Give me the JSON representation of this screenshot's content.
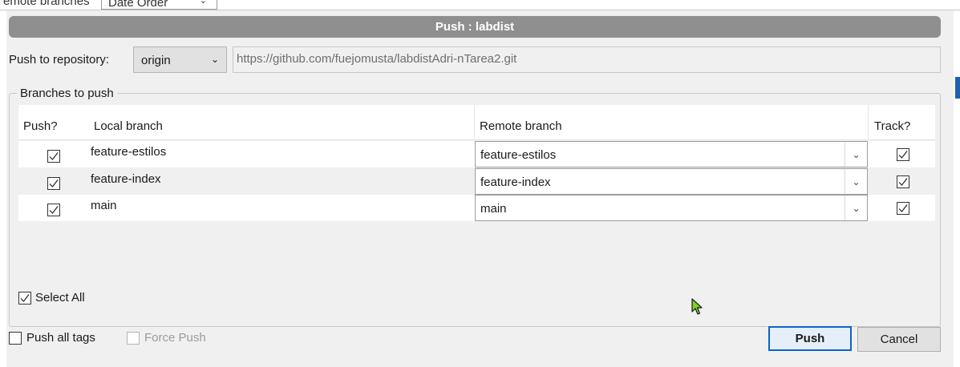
{
  "background": {
    "partial_text": "emote branches",
    "partial_select": "Date Order"
  },
  "dialog": {
    "title": "Push : labdist"
  },
  "repository": {
    "label": "Push to repository:",
    "selected": "origin",
    "url": "https://github.com/fuejomusta/labdistAdri-nTarea2.git"
  },
  "branches": {
    "group_label": "Branches to push",
    "columns": {
      "push": "Push?",
      "local": "Local branch",
      "remote": "Remote branch",
      "track": "Track?"
    },
    "rows": [
      {
        "push": true,
        "local": "feature-estilos",
        "remote": "feature-estilos",
        "track": true
      },
      {
        "push": true,
        "local": "feature-index",
        "remote": "feature-index",
        "track": true
      },
      {
        "push": true,
        "local": "main",
        "remote": "main",
        "track": true
      }
    ],
    "select_all_label": "Select All",
    "select_all_checked": true
  },
  "options": {
    "push_all_tags_label": "Push all tags",
    "push_all_tags_checked": false,
    "force_push_label": "Force Push",
    "force_push_checked": false,
    "force_push_enabled": false
  },
  "buttons": {
    "push": "Push",
    "cancel": "Cancel"
  },
  "colors": {
    "title_bar": "#8f8f8f",
    "primary_border": "#0a64c8",
    "cursor": "#7ed321"
  }
}
